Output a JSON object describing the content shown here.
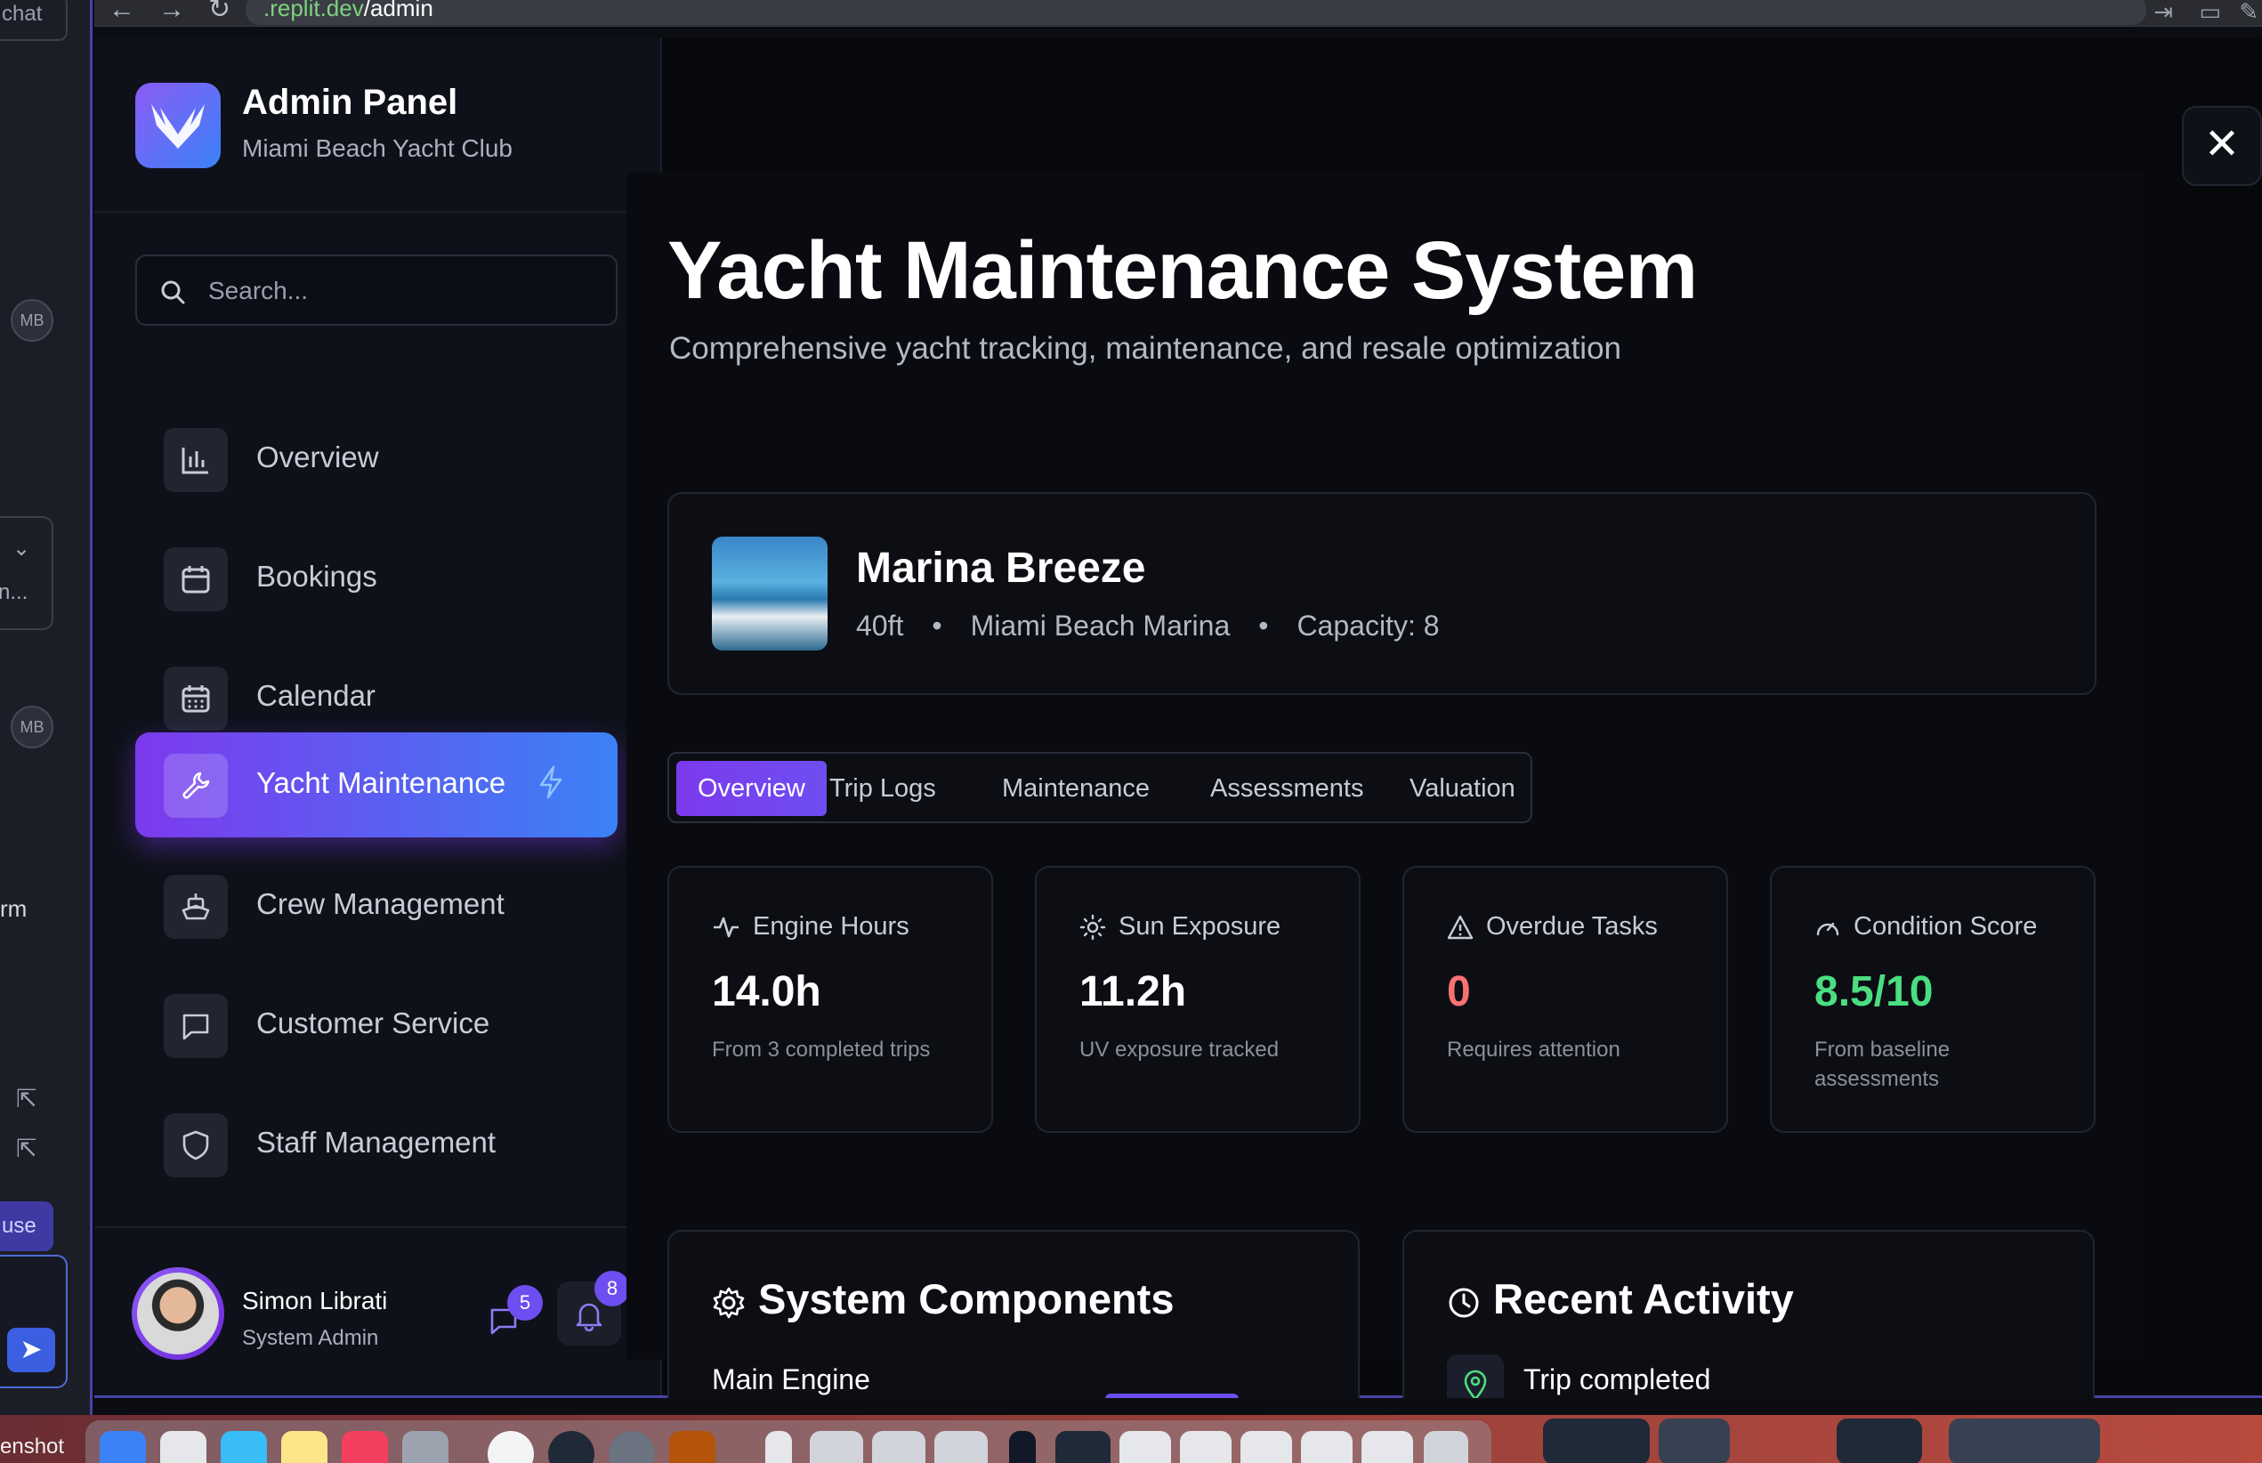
{
  "browser": {
    "url_prefix": ".replit.dev",
    "url_path": "/admin"
  },
  "left_strip": {
    "chat_label": "chat",
    "badge_1": "MB",
    "badge_2": "MB",
    "truncated_text": "n...",
    "rm_text": "rm",
    "use_label": "use"
  },
  "sidebar": {
    "title": "Admin Panel",
    "subtitle": "Miami Beach Yacht Club",
    "search_placeholder": "Search...",
    "items": [
      {
        "label": "Overview",
        "icon": "bar-chart-icon"
      },
      {
        "label": "Bookings",
        "icon": "calendar-icon"
      },
      {
        "label": "Calendar",
        "icon": "calendar-grid-icon"
      },
      {
        "label": "Yacht Maintenance",
        "icon": "wrench-icon",
        "active": true
      },
      {
        "label": "Crew Management",
        "icon": "ship-icon"
      },
      {
        "label": "Customer Service",
        "icon": "message-square-icon"
      },
      {
        "label": "Staff Management",
        "icon": "shield-icon"
      }
    ],
    "user": {
      "name": "Simon Librati",
      "role": "System Admin",
      "messages_count": "5",
      "notifications_count": "8"
    }
  },
  "main": {
    "title": "Yacht Maintenance System",
    "subtitle": "Comprehensive yacht tracking, maintenance, and resale optimization",
    "yacht": {
      "name": "Marina Breeze",
      "length": "40ft",
      "location": "Miami Beach Marina",
      "capacity": "Capacity: 8"
    },
    "tabs": [
      {
        "label": "Overview",
        "active": true
      },
      {
        "label": "Trip Logs"
      },
      {
        "label": "Maintenance"
      },
      {
        "label": "Assessments"
      },
      {
        "label": "Valuation"
      }
    ],
    "stats": [
      {
        "title": "Engine Hours",
        "value": "14.0h",
        "note": "From 3 completed trips",
        "icon": "activity-icon",
        "color": "#ffffff"
      },
      {
        "title": "Sun Exposure",
        "value": "11.2h",
        "note": "UV exposure tracked",
        "icon": "sun-icon",
        "color": "#ffffff"
      },
      {
        "title": "Overdue Tasks",
        "value": "0",
        "note": "Requires attention",
        "icon": "alert-triangle-icon",
        "color": "#f87171"
      },
      {
        "title": "Condition Score",
        "value": "8.5/10",
        "note": "From baseline assessments",
        "icon": "gauge-icon",
        "color": "#4ade80"
      }
    ],
    "components": {
      "title": "System Components",
      "first_row": "Main Engine"
    },
    "activity": {
      "title": "Recent Activity",
      "first_row": "Trip completed"
    }
  },
  "dock": {
    "partial_label": "enshot"
  },
  "colors": {
    "accent_purple": "#7c3aed",
    "accent_blue": "#3b82f6",
    "danger": "#f87171",
    "success": "#4ade80"
  }
}
